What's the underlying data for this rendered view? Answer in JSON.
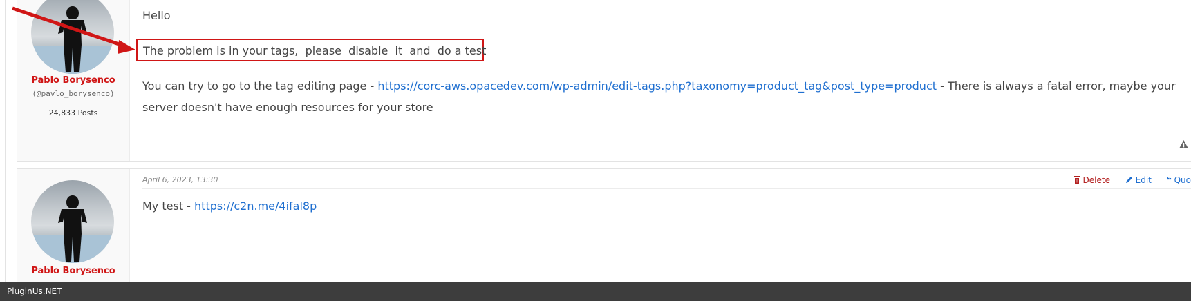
{
  "posts": [
    {
      "author": {
        "name": "Pablo Borysenco",
        "handle": "(@pavlo_borysenco)",
        "posts": "24,833 Posts"
      },
      "greeting": "Hello",
      "highlight": "The problem is in your tags,  please  disable  it  and  do a test",
      "para_before": "You can try to go to the tag editing page - ",
      "link": "https://corc-aws.opacedev.com/wp-admin/edit-tags.php?taxonomy=product_tag&post_type=product",
      "para_after": "  - There is always a fatal error, maybe your server doesn't have enough resources for your store",
      "warn_icon": "warning-triangle-icon"
    },
    {
      "author": {
        "name": "Pablo Borysenco"
      },
      "date": "April 6, 2023, 13:30",
      "actions": {
        "delete": "Delete",
        "edit": "Edit",
        "quote": "Quo"
      },
      "text_before": "My  test -  ",
      "link": "https://c2n.me/4ifal8p"
    }
  ],
  "footer": {
    "brand": "PluginUs.NET"
  },
  "colors": {
    "accent_red": "#d01616",
    "link_blue": "#1f6fd0",
    "footer_bg": "#3d3d3d"
  }
}
